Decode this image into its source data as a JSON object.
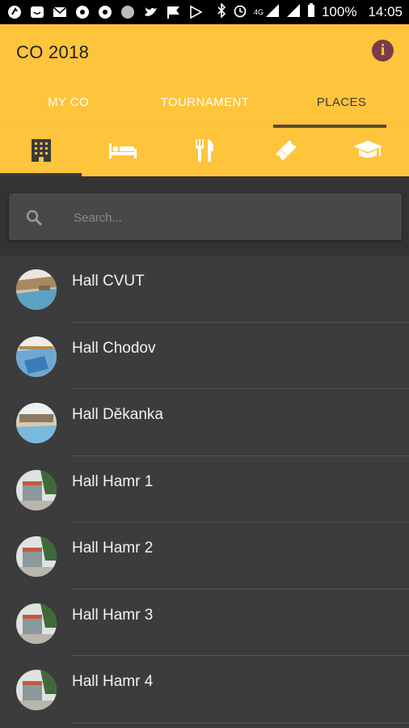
{
  "status_bar": {
    "battery": "100%",
    "time": "14:05",
    "network": "4G"
  },
  "app": {
    "title": "CO 2018",
    "info_icon_glyph": "i",
    "accent_color": "#fec43c",
    "background_color": "#3c3c3c"
  },
  "tabs": [
    {
      "label": "MY CO",
      "active": false
    },
    {
      "label": "TOURNAMENT",
      "active": false
    },
    {
      "label": "PLACES",
      "active": true
    }
  ],
  "category_tabs": [
    {
      "icon": "building-icon",
      "active": true
    },
    {
      "icon": "hotel-bed-icon",
      "active": false
    },
    {
      "icon": "restaurant-icon",
      "active": false
    },
    {
      "icon": "ticket-icon",
      "active": false
    },
    {
      "icon": "graduation-cap-icon",
      "active": false
    }
  ],
  "search": {
    "placeholder": "Search..."
  },
  "places": [
    {
      "name": "Hall CVUT"
    },
    {
      "name": "Hall Chodov"
    },
    {
      "name": "Hall Děkanka"
    },
    {
      "name": "Hall Hamr 1"
    },
    {
      "name": "Hall Hamr 2"
    },
    {
      "name": "Hall Hamr 3"
    },
    {
      "name": "Hall Hamr 4"
    }
  ]
}
